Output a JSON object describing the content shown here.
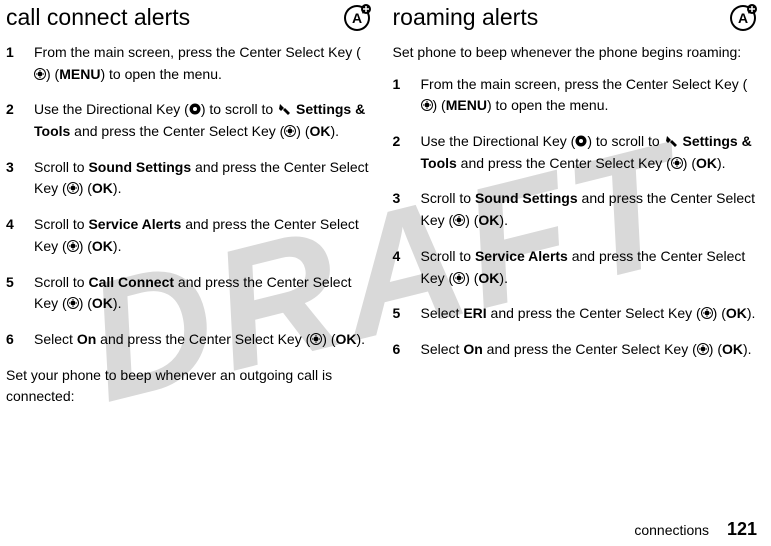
{
  "watermark": "DRAFT",
  "left": {
    "title": "call connect alerts",
    "intro": "Set your phone to beep whenever an outgoing call is connected:",
    "steps": [
      {
        "n": "1",
        "pre": "From the main screen, press the Center Select Key (",
        "post": ") (",
        "bold": "MENU",
        "tail": ") to open the menu."
      },
      {
        "n": "2",
        "pre": "Use the Directional Key (",
        "post": ") to scroll to ",
        "bold": "Settings & Tools",
        "mid2": " and press the Center Select Key (",
        "bold2": "OK",
        "tail": ")."
      },
      {
        "n": "3",
        "pre": "Scroll to ",
        "bold": "Sound Settings",
        "mid": " and press the Center Select Key (",
        "bold2": "OK",
        "tail": ")."
      },
      {
        "n": "4",
        "pre": "Scroll to ",
        "bold": "Service Alerts",
        "mid": " and press the Center Select Key (",
        "bold2": "OK",
        "tail": ")."
      },
      {
        "n": "5",
        "pre": "Scroll to ",
        "bold": "Call Connect",
        "mid": " and press the Center Select Key (",
        "bold2": "OK",
        "tail": ")."
      },
      {
        "n": "6",
        "pre": "Select ",
        "bold": "On",
        "mid": " and press the Center Select Key (",
        "bold2": "OK",
        "tail": ")."
      }
    ]
  },
  "right": {
    "title": "roaming alerts",
    "intro": "Set phone to beep whenever the phone begins roaming:",
    "steps": [
      {
        "n": "1",
        "pre": "From the main screen, press the Center Select Key (",
        "post": ") (",
        "bold": "MENU",
        "tail": ") to open the menu."
      },
      {
        "n": "2",
        "pre": "Use the Directional Key (",
        "post": ") to scroll to ",
        "bold": "Settings & Tools",
        "mid2": " and press the Center Select Key (",
        "bold2": "OK",
        "tail": ")."
      },
      {
        "n": "3",
        "pre": "Scroll to ",
        "bold": "Sound Settings",
        "mid": " and press the Center Select Key (",
        "bold2": "OK",
        "tail": ")."
      },
      {
        "n": "4",
        "pre": "Scroll to ",
        "bold": "Service Alerts",
        "mid": " and press the Center Select Key (",
        "bold2": "OK",
        "tail": ")."
      },
      {
        "n": "5",
        "pre": "Select ",
        "bold": "ERI",
        "mid": " and press the Center Select Key (",
        "bold2": "OK",
        "tail": ")."
      },
      {
        "n": "6",
        "pre": "Select ",
        "bold": "On",
        "mid": " and press the Center Select Key (",
        "bold2": "OK",
        "tail": ")."
      }
    ]
  },
  "footer": {
    "section": "connections",
    "page": "121"
  }
}
